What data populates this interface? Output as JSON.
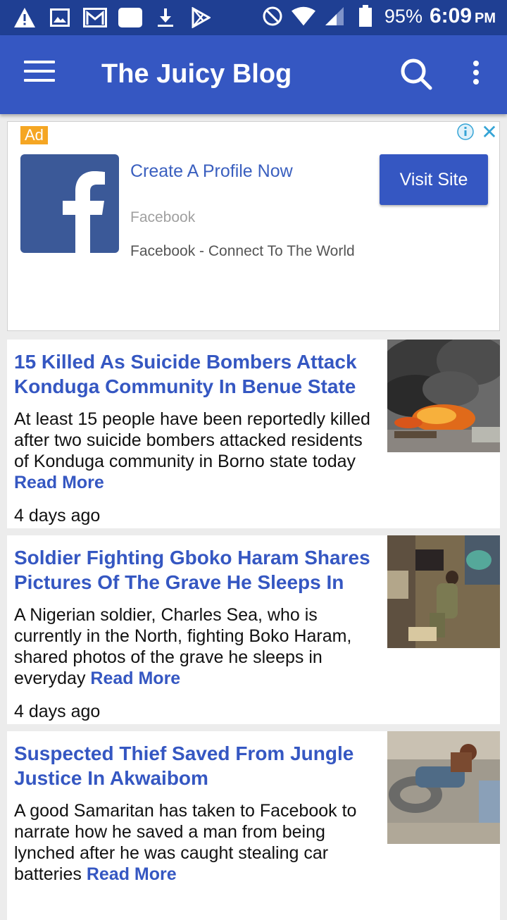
{
  "status_bar": {
    "battery": "95%",
    "time": "6:09",
    "ampm": "PM"
  },
  "app_bar": {
    "title": "The Juicy Blog"
  },
  "ad": {
    "badge": "Ad",
    "close": "✕",
    "headline": "Create A Profile Now",
    "source": "Facebook",
    "description": "Facebook - Connect To The World",
    "cta": "Visit Site"
  },
  "articles": [
    {
      "title": "15 Killed As Suicide Bombers Attack Konduga Community In Benue State",
      "excerpt": "At least 15 people have been reportedly killed after two suicide bombers attacked residents of Konduga community in Borno state today",
      "read_more": "Read More",
      "time": "4 days ago"
    },
    {
      "title": "Soldier Fighting Gboko Haram Shares Pictures Of The Grave He Sleeps In",
      "excerpt": "A Nigerian soldier, Charles Sea, who is currently in the North, fighting Boko Haram, shared photos of the grave he sleeps in everyday",
      "read_more": "Read More",
      "time": "4 days ago"
    },
    {
      "title": "Suspected Thief Saved From Jungle Justice In Akwaibom",
      "excerpt": "A good Samaritan has taken to Facebook to narrate how he saved a man from being lynched after he was caught stealing car batteries",
      "read_more": "Read More",
      "time": ""
    }
  ],
  "colors": {
    "status_bar": "#1f3f93",
    "app_bar": "#3557c2",
    "link": "#3557c2",
    "ad_badge": "#f5a623",
    "facebook": "#3b5998"
  }
}
